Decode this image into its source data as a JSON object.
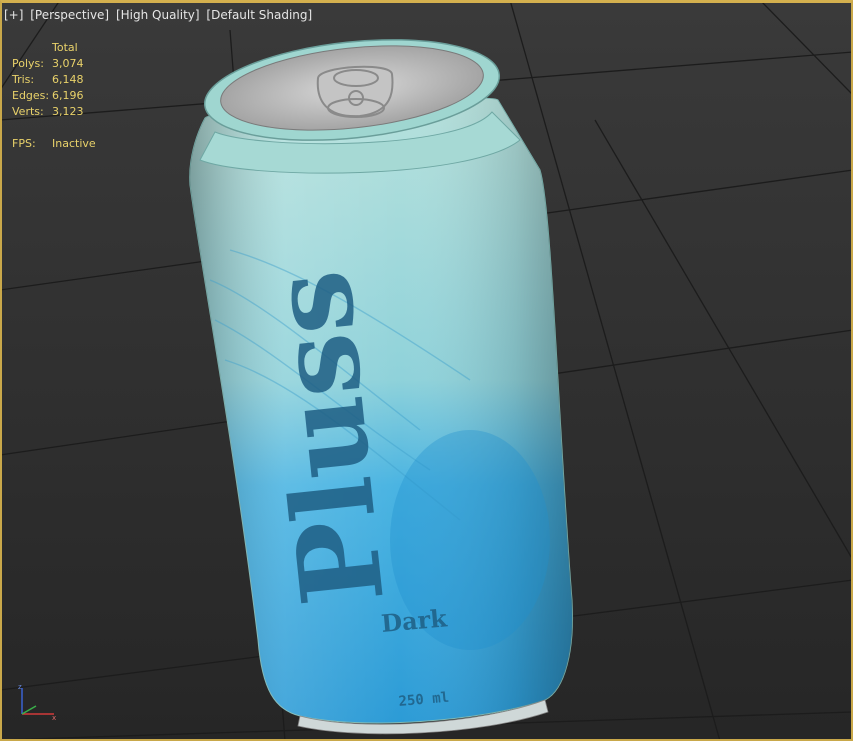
{
  "viewport_menu": {
    "plus": "[+]",
    "perspective": "[Perspective]",
    "quality": "[High Quality]",
    "shading": "[Default Shading]"
  },
  "stats": {
    "header": "Total",
    "polys_label": "Polys:",
    "polys_value": "3,074",
    "tris_label": "Tris:",
    "tris_value": "6,148",
    "edges_label": "Edges:",
    "edges_value": "6,196",
    "verts_label": "Verts:",
    "verts_value": "3,123",
    "fps_label": "FPS:",
    "fps_value": "Inactive"
  },
  "can_label": {
    "brand": "Pluss",
    "variant": "Dark",
    "volume": "250 ml"
  },
  "colors": {
    "viewport_border": "#d4b04e",
    "stats_text": "#e9d26a",
    "can_top": "#aedbd7",
    "can_bottom": "#2e9fd8",
    "label_text": "#1f5e84"
  }
}
